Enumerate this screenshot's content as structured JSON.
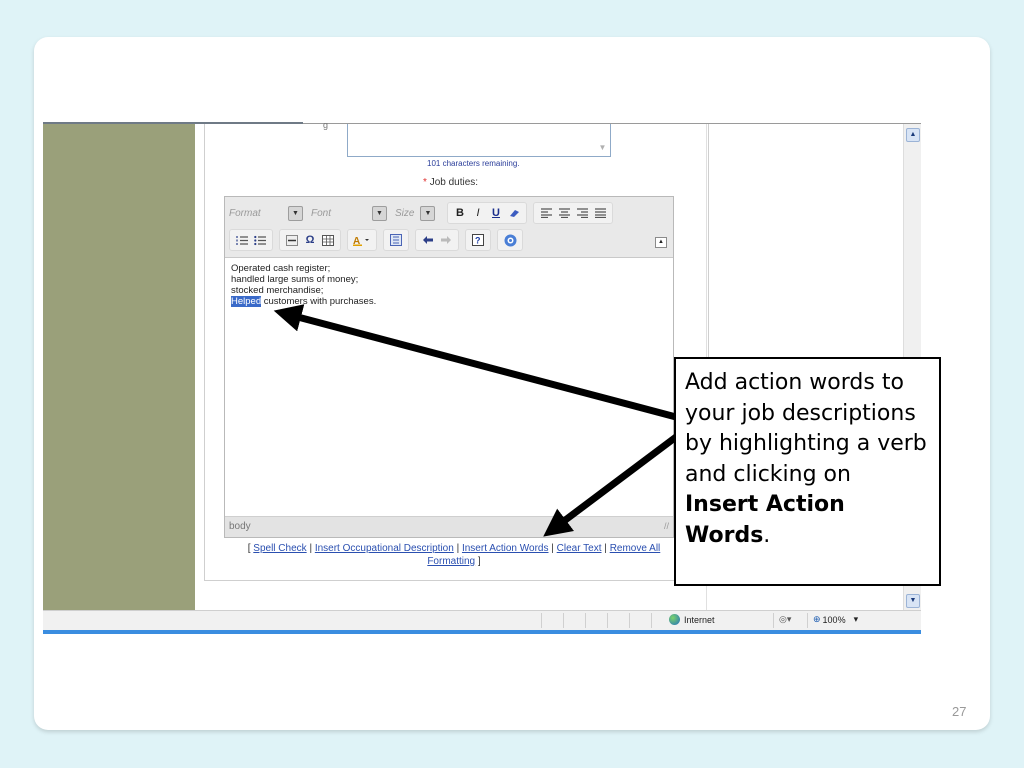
{
  "slide": {
    "page_number": "27"
  },
  "form": {
    "chars_remaining": "101 characters remaining.",
    "required_mark": "*",
    "job_duties_label": "Job duties:",
    "prev_field_glyph": "g"
  },
  "toolbar": {
    "format": "Format",
    "font": "Font",
    "size": "Size",
    "bold": "B",
    "italic": "I",
    "underline": "U",
    "row1_icons": [
      "eraser-icon",
      "align-left-icon",
      "align-center-icon",
      "align-right-icon",
      "align-justify-icon"
    ],
    "row2_icons": [
      "numbered-list-icon",
      "bulleted-list-icon",
      "horizontal-rule-icon",
      "special-char-icon",
      "table-icon",
      "text-color-icon",
      "insert-action-words-icon",
      "undo-icon",
      "redo-icon",
      "help-icon",
      "spell-check-icon"
    ]
  },
  "editor": {
    "lines": [
      "Operated cash register;",
      "handled large sums of money;",
      "stocked merchandise;"
    ],
    "selected_word": "Helped",
    "line4_rest": " customers with purchases.",
    "status_path": "body"
  },
  "links": {
    "open": "[",
    "spell_check": "Spell Check",
    "sep": "|",
    "insert_occupational": "Insert Occupational Description",
    "insert_action_words": "Insert Action Words",
    "clear_text": "Clear Text",
    "remove_formatting": "Remove All Formatting",
    "close": "]"
  },
  "browser": {
    "zone": "Internet",
    "zoom": "100%"
  },
  "callout": {
    "text_before": "Add action words to your job descriptions by highlighting a verb and clicking on ",
    "bold_text": "Insert Action Words",
    "text_after": "."
  },
  "colors": {
    "highlight": "#3a6ac9",
    "olive_panel": "#9aa07a",
    "link": "#2a4fb0",
    "ie_blue": "#3a8de0"
  }
}
